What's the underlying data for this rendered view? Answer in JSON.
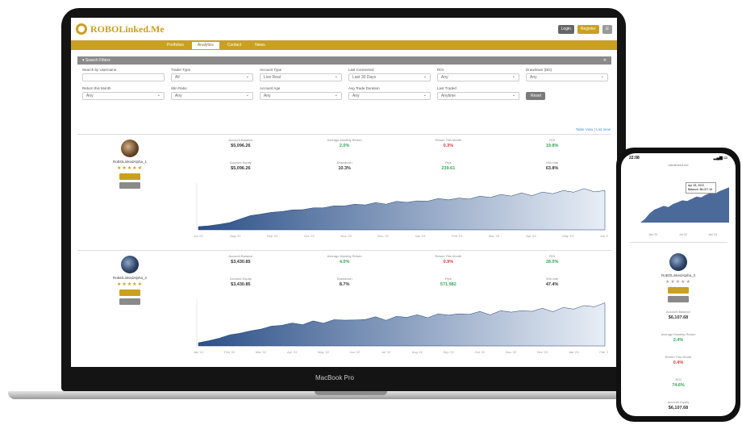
{
  "app": {
    "logo_text": "ROBOLinked.Me",
    "device_label": "MacBook Pro"
  },
  "topbar": {
    "login": "Login",
    "register": "Register",
    "menu": "☰"
  },
  "nav": [
    {
      "label": "Portfolios"
    },
    {
      "label": "Analytics"
    },
    {
      "label": "Contact"
    },
    {
      "label": "News"
    }
  ],
  "search_panel": {
    "title": "Search Filters",
    "close": "✕"
  },
  "filters": {
    "row1": [
      {
        "label": "Search by Username",
        "type": "input",
        "value": ""
      },
      {
        "label": "Trader Type",
        "value": "All"
      },
      {
        "label": "Account Type",
        "value": "Live Real"
      },
      {
        "label": "Last Connected",
        "value": "Last 30 Days"
      },
      {
        "label": "ROI",
        "value": "Any"
      },
      {
        "label": "Drawdown (DD)",
        "value": "Any"
      }
    ],
    "row2": [
      {
        "label": "Return this Month",
        "value": "Any"
      },
      {
        "label": "Win Ratio",
        "value": "Any"
      },
      {
        "label": "Account Age",
        "value": "Any"
      },
      {
        "label": "Avg Trade Duration",
        "value": "Any"
      },
      {
        "label": "Last Traded",
        "value": "Anytime"
      }
    ],
    "reset": "Reset"
  },
  "view_links": "Table View | List View",
  "traders": [
    {
      "username": "RoBOLinkedAlpha_1",
      "stats": [
        {
          "label": "Account Balance",
          "value": "$5,096.26",
          "tone": ""
        },
        {
          "label": "Average Monthly Return",
          "value": "2.0%",
          "tone": "g"
        },
        {
          "label": "Return This Month",
          "value": "0.3%",
          "tone": "r"
        },
        {
          "label": "ROI",
          "value": "19.8%",
          "tone": "g"
        },
        {
          "label": "Account Equity",
          "value": "$5,096.26",
          "tone": ""
        },
        {
          "label": "Drawdown",
          "value": "10.3%",
          "tone": ""
        },
        {
          "label": "Pips",
          "value": "239.61",
          "tone": "g"
        },
        {
          "label": "Win rate",
          "value": "63.8%",
          "tone": ""
        }
      ],
      "x_ticks": [
        "Jul '22",
        "Aug '22",
        "Sep '22",
        "Oct '22",
        "Nov '22",
        "Dec '22",
        "Jan '23",
        "Feb '23",
        "Mar '23",
        "Apr '23",
        "May '23",
        "Jun '23"
      ]
    },
    {
      "username": "RoBOLinkedAlpha_2",
      "stats": [
        {
          "label": "Account Balance",
          "value": "$3,430.85",
          "tone": ""
        },
        {
          "label": "Average Monthly Return",
          "value": "4.0%",
          "tone": "g"
        },
        {
          "label": "Return This Month",
          "value": "0.9%",
          "tone": "r"
        },
        {
          "label": "ROI",
          "value": "28.0%",
          "tone": "g"
        },
        {
          "label": "Account Equity",
          "value": "$3,430.85",
          "tone": ""
        },
        {
          "label": "Drawdown",
          "value": "8.7%",
          "tone": ""
        },
        {
          "label": "Pips",
          "value": "571.982",
          "tone": "g"
        },
        {
          "label": "Win rate",
          "value": "47.4%",
          "tone": ""
        }
      ],
      "x_ticks": [
        "Jan '22",
        "Feb '22",
        "Mar '22",
        "Apr '22",
        "May '22",
        "Jun '22",
        "Jul '22",
        "Aug '22",
        "Sep '22",
        "Oct '22",
        "Nov '22",
        "Dec '22",
        "Jan '23",
        "Feb '23"
      ]
    }
  ],
  "phone": {
    "time": "22:08",
    "signal": "▂▄▆ ▭",
    "url": "robolinked.me",
    "tooltip": [
      "Apr 28, 2022",
      "Balance: $6,027.16"
    ],
    "x_ticks": [
      "Jan '22",
      "Jul '22",
      "Jan '23"
    ],
    "username": "RoBOLinkedAlpha_3",
    "stats": [
      {
        "label": "Account Balance",
        "value": "$6,107.68",
        "tone": ""
      },
      {
        "label": "Average Monthly Return",
        "value": "2.4%",
        "tone": "g"
      },
      {
        "label": "Return This Month",
        "value": "0.4%",
        "tone": "r"
      },
      {
        "label": "ROI",
        "value": "74.6%",
        "tone": "g"
      },
      {
        "label": "Account Equity",
        "value": "$6,107.68",
        "tone": ""
      }
    ]
  },
  "colors": {
    "gold": "#c9a021",
    "chart_fill": "#2c5088",
    "green": "#3aa35a",
    "red": "#d23c3c"
  }
}
